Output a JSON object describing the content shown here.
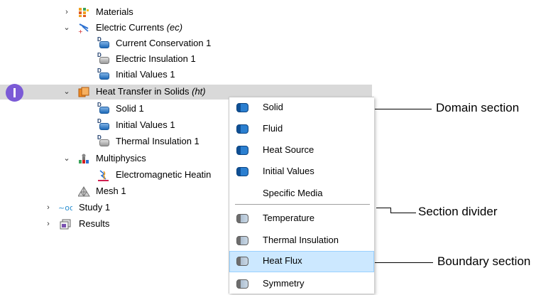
{
  "tree": {
    "items": [
      {
        "label": "Materials",
        "tag": ""
      },
      {
        "label": "Electric Currents ",
        "tag": "(ec)"
      },
      {
        "label": "Current Conservation 1",
        "tag": ""
      },
      {
        "label": "Electric Insulation 1",
        "tag": ""
      },
      {
        "label": "Initial Values 1",
        "tag": ""
      },
      {
        "label": "Heat Transfer in Solids ",
        "tag": "(ht)"
      },
      {
        "label": "Solid 1",
        "tag": ""
      },
      {
        "label": "Initial Values 1",
        "tag": ""
      },
      {
        "label": "Thermal Insulation 1",
        "tag": ""
      },
      {
        "label": "Multiphysics",
        "tag": ""
      },
      {
        "label": "Electromagnetic Heatin",
        "tag": ""
      },
      {
        "label": "Mesh 1",
        "tag": ""
      },
      {
        "label": "Study 1",
        "tag": ""
      },
      {
        "label": "Results",
        "tag": ""
      }
    ]
  },
  "menu": {
    "items": [
      {
        "label": "Solid",
        "icon": "domain-blue-icon"
      },
      {
        "label": "Fluid",
        "icon": "domain-blue-icon"
      },
      {
        "label": "Heat Source",
        "icon": "domain-blue-icon"
      },
      {
        "label": "Initial Values",
        "icon": "domain-blue-icon"
      },
      {
        "label": "Specific Media",
        "icon": ""
      },
      {
        "label": "Temperature",
        "icon": "boundary-grey-icon"
      },
      {
        "label": "Thermal Insulation",
        "icon": "boundary-grey-icon"
      },
      {
        "label": "Heat Flux",
        "icon": "boundary-grey-icon"
      },
      {
        "label": "Symmetry",
        "icon": "boundary-grey-icon"
      }
    ],
    "highlighted": "Heat Flux"
  },
  "callouts": {
    "domain": "Domain section",
    "divider": "Section divider",
    "boundary": "Boundary section"
  },
  "colors": {
    "badge": "#7b5ad6",
    "selected_row": "#d9d9d9",
    "hover": "#cce8ff"
  }
}
